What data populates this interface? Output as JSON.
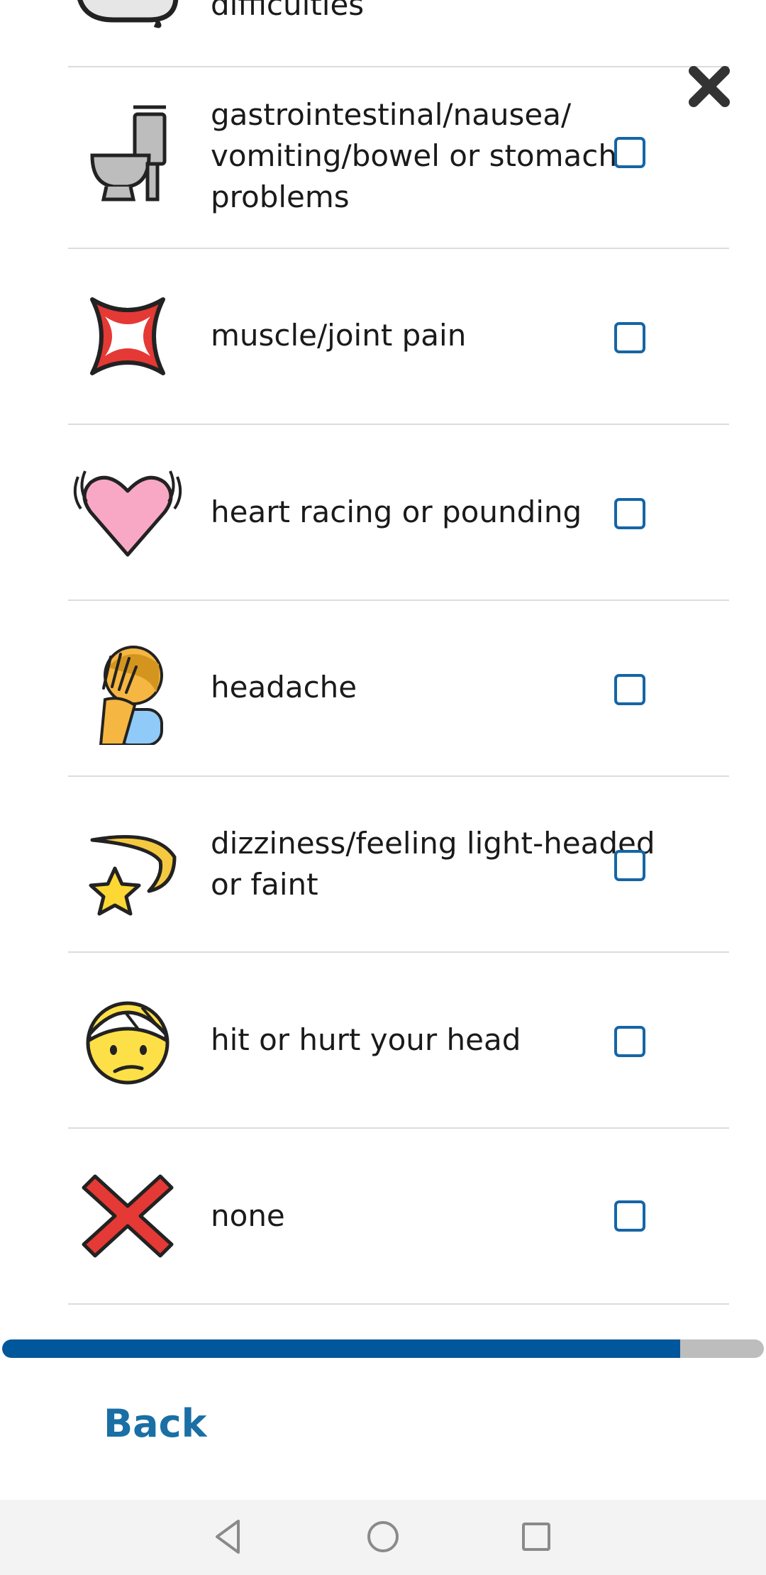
{
  "partial_item": {
    "label": "difficulties",
    "icon": "speech-bubble-icon"
  },
  "close_button": {
    "icon": "close-icon"
  },
  "items": [
    {
      "label": "gastrointestinal/nausea/ vomiting/bowel or stomach problems",
      "icon": "toilet-icon",
      "checked": false
    },
    {
      "label": "muscle/joint pain",
      "icon": "anger-symbol-icon",
      "checked": false
    },
    {
      "label": "heart racing or pounding",
      "icon": "beating-heart-icon",
      "checked": false
    },
    {
      "label": "headache",
      "icon": "facepalm-person-icon",
      "checked": false
    },
    {
      "label": "dizziness/feeling light-headed or faint",
      "icon": "dizzy-star-icon",
      "checked": false
    },
    {
      "label": "hit or hurt your head",
      "icon": "head-bandage-face-icon",
      "checked": false
    },
    {
      "label": "none",
      "icon": "cross-mark-icon",
      "checked": false
    }
  ],
  "progress": {
    "fraction": 0.89
  },
  "back_label": "Back",
  "nav": {
    "back": "nav-back-icon",
    "home": "nav-home-icon",
    "recents": "nav-recents-icon"
  },
  "colors": {
    "accent": "#1565a6",
    "progress": "#01579b",
    "progress_track": "#bdbdbd",
    "link": "#1a6fa5"
  }
}
